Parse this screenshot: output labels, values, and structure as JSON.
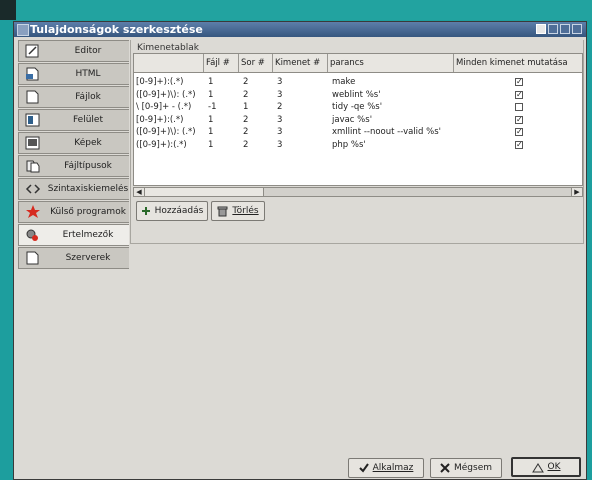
{
  "window": {
    "title": "Tulajdonságok szerkesztése"
  },
  "sidebar": {
    "items": [
      {
        "label": "Editor",
        "icon": "editor-icon"
      },
      {
        "label": "HTML",
        "icon": "html-icon"
      },
      {
        "label": "Fájlok",
        "icon": "file-icon"
      },
      {
        "label": "Felület",
        "icon": "interface-icon"
      },
      {
        "label": "Képek",
        "icon": "image-icon"
      },
      {
        "label": "Fájltípusok",
        "icon": "filetypes-icon"
      },
      {
        "label": "Szintaxiskiemelés",
        "icon": "syntax-icon"
      },
      {
        "label": "Külső programok",
        "icon": "star-icon"
      },
      {
        "label": "Értelmezők",
        "icon": "parser-icon"
      },
      {
        "label": "Szerverek",
        "icon": "server-icon"
      }
    ],
    "selected": "Értelmezők"
  },
  "panel": {
    "group_label": "Kimenetablak",
    "columns": [
      "",
      "Fájl #",
      "Sor #",
      "Kimenet #",
      "parancs",
      "Minden kimenet mutatása"
    ],
    "rows": [
      {
        "pattern": "[0-9]+):(.*)",
        "file": "1",
        "line": "2",
        "output": "3",
        "command": "make",
        "show_all": true
      },
      {
        "pattern": "([0-9]+)\\): (.*)",
        "file": "1",
        "line": "2",
        "output": "3",
        "command": "weblint %s'",
        "show_all": true
      },
      {
        "pattern": "\\ [0-9]+ - (.*)",
        "file": "-1",
        "line": "1",
        "output": "2",
        "command": "tidy -qe %s'",
        "show_all": false
      },
      {
        "pattern": "[0-9]+):(.*)",
        "file": "1",
        "line": "2",
        "output": "3",
        "command": "javac %s'",
        "show_all": true
      },
      {
        "pattern": "([0-9]+)\\): (.*)",
        "file": "1",
        "line": "2",
        "output": "3",
        "command": "xmllint --noout --valid %s'",
        "show_all": true
      },
      {
        "pattern": "([0-9]+):(.*)",
        "file": "1",
        "line": "2",
        "output": "3",
        "command": "php %s'",
        "show_all": true
      }
    ],
    "add_button": "Hozzáadás",
    "delete_button": "Törlés"
  },
  "footer": {
    "apply": "Alkalmaz",
    "cancel": "Mégsem",
    "ok": "OK"
  }
}
